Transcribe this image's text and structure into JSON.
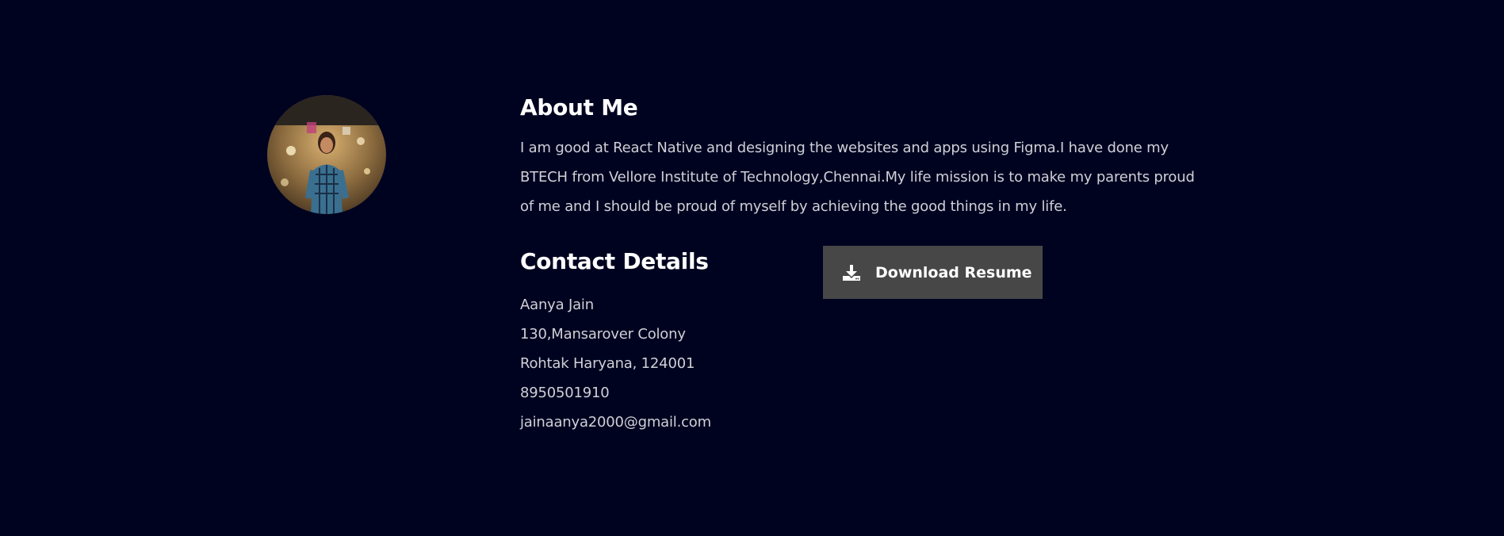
{
  "profile": {
    "photo_alt": "Profile photo"
  },
  "about": {
    "heading": "About Me",
    "text": "I am good at React Native and designing the websites and apps using Figma.I have done my BTECH from Vellore Institute of Technology,Chennai.My life mission is to make my parents proud of me and I should be proud of myself by achieving the good things in my life."
  },
  "contact": {
    "heading": "Contact Details",
    "name": "Aanya Jain",
    "address_line1": "130,Mansarover Colony",
    "address_line2": "Rohtak Haryana, 124001",
    "phone": "8950501910",
    "email": "jainaanya2000@gmail.com"
  },
  "download": {
    "label": "Download Resume",
    "icon": "download-icon"
  },
  "colors": {
    "background": "#000320",
    "button": "#474747",
    "heading": "#ffffff",
    "body_text": "#cfd0d6"
  }
}
